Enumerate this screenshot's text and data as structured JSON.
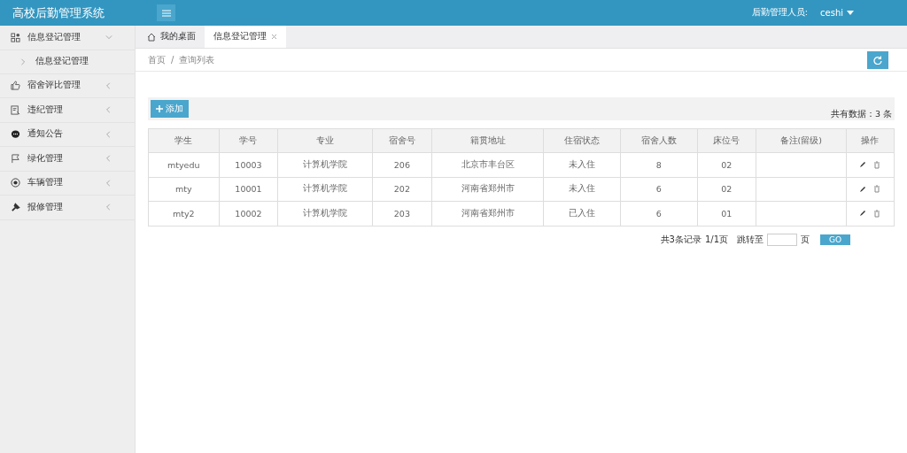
{
  "header": {
    "title": "高校后勤管理系统",
    "user_label": "后勤管理人员:",
    "user_name": "ceshi"
  },
  "sidebar": {
    "items": [
      {
        "label": "信息登记管理",
        "expanded": true,
        "children": [
          {
            "label": "信息登记管理"
          }
        ]
      },
      {
        "label": "宿舍评比管理",
        "expanded": false
      },
      {
        "label": "违纪管理",
        "expanded": false
      },
      {
        "label": "通知公告",
        "expanded": false
      },
      {
        "label": "绿化管理",
        "expanded": false
      },
      {
        "label": "车辆管理",
        "expanded": false
      },
      {
        "label": "报修管理",
        "expanded": false
      }
    ]
  },
  "tabs": [
    {
      "label": "我的桌面",
      "selected": false,
      "closable": false
    },
    {
      "label": "信息登记管理",
      "selected": true,
      "closable": true
    }
  ],
  "breadcrumb": [
    "首页",
    "/",
    "查询列表"
  ],
  "toolbar": {
    "add_button": "添加",
    "total": "共有数据：3 条"
  },
  "table": {
    "columns": [
      "学生",
      "学号",
      "专业",
      "宿舍号",
      "籍贯地址",
      "住宿状态",
      "宿舍人数",
      "床位号",
      "备注(留级)",
      "操作"
    ],
    "rows": [
      [
        "mtyedu",
        "10003",
        "计算机学院",
        "206",
        "北京市丰台区",
        "未入住",
        "8",
        "02",
        ""
      ],
      [
        "mty",
        "10001",
        "计算机学院",
        "202",
        "河南省郑州市",
        "未入住",
        "6",
        "02",
        ""
      ],
      [
        "mty2",
        "10002",
        "计算机学院",
        "203",
        "河南省郑州市",
        "已入住",
        "6",
        "01",
        ""
      ]
    ]
  },
  "pagination": {
    "records": "共3条记录",
    "pages": "1/1页",
    "jump_label": "跳转至",
    "page_unit": "页",
    "go_button": "GO"
  }
}
